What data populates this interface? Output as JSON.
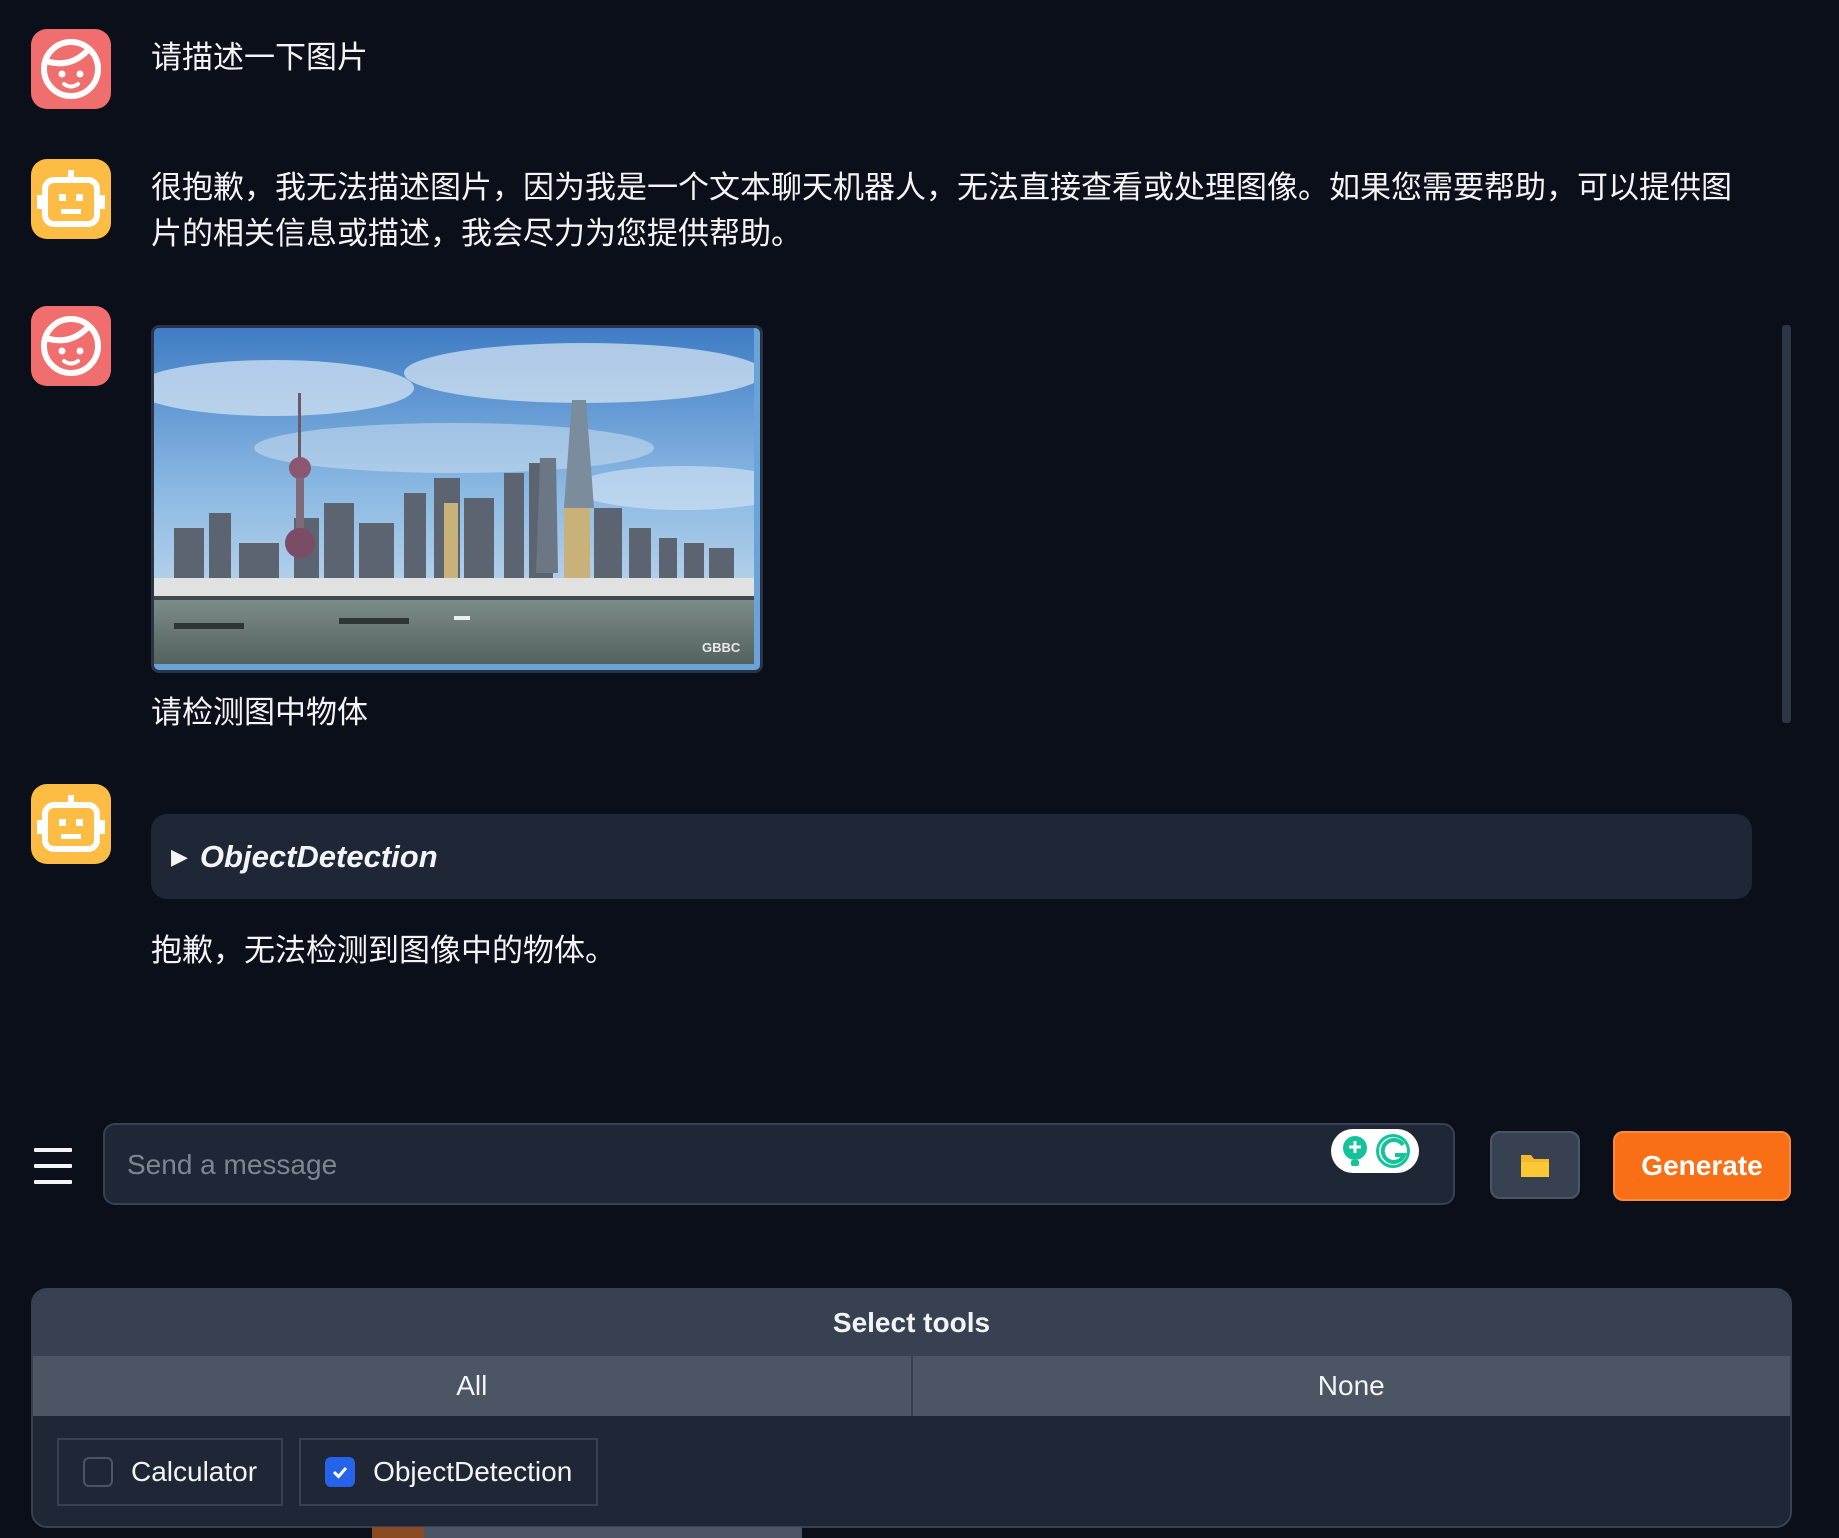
{
  "conversation": {
    "messages": [
      {
        "role": "user",
        "text": "请描述一下图片"
      },
      {
        "role": "bot",
        "text": "很抱歉，我无法描述图片，因为我是一个文本聊天机器人，无法直接查看或处理图像。如果您需要帮助，可以提供图片的相关信息或描述，我会尽力为您提供帮助。"
      },
      {
        "role": "user",
        "image": "shanghai-skyline-photo",
        "image_watermark": "GBBC",
        "text": "请检测图中物体"
      },
      {
        "role": "bot",
        "tool_call": {
          "name": "ObjectDetection",
          "expanded": false
        },
        "text": "抱歉，无法检测到图像中的物体。"
      }
    ]
  },
  "input": {
    "placeholder": "Send a message",
    "value": ""
  },
  "buttons": {
    "upload_icon": "folder-icon",
    "generate_label": "Generate"
  },
  "tools": {
    "title": "Select tools",
    "choices": [
      "All",
      "None"
    ],
    "options": [
      {
        "label": "Calculator",
        "checked": false
      },
      {
        "label": "ObjectDetection",
        "checked": true
      }
    ]
  },
  "colors": {
    "background": "#0b0f19",
    "user_avatar": "#f16e6e",
    "bot_avatar": "#fdbd45",
    "accent": "#f96f16",
    "checkbox_checked": "#2563eb"
  }
}
